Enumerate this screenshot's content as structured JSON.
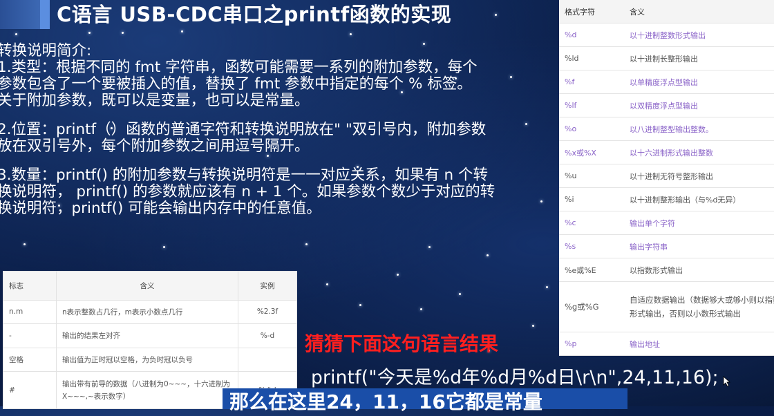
{
  "slide": {
    "title": "C语言 USB-CDC串口之printf函数的实现",
    "body_lines": [
      "转换说明简介:",
      "1.类型：根据不同的 fmt 字符串，函数可能需要一系列的附加参数，每个",
      "参数包含了一个要被插入的值，替换了 fmt 参数中指定的每个 % 标签。",
      "关于附加参数，既可以是变量，也可以是常量。",
      "",
      "2.位置：printf（）函数的普通字符和转换说明放在\" \"双引号内，附加参数",
      "放在双引号外，每个附加参数之间用逗号隔开。",
      "",
      "3.数量：printf() 的附加参数与转换说明符是一一对应关系，如果有 n 个转",
      "换说明符， printf() 的参数就应该有 n + 1 个。如果参数个数少于对应的转",
      "换说明符，printf() 可能会输出内存中的任意值。"
    ],
    "question": "猜猜下面这句语言结果",
    "code": "printf(\"今天是%d年%d月%d日\\r\\n\",24,11,16);",
    "bottom_text": "那么在这里24，11，16它都是常量"
  },
  "format_table": {
    "headers": [
      "格式字符",
      "含义"
    ],
    "rows": [
      {
        "spec": "%d",
        "desc": "以十进制整数形式输出"
      },
      {
        "spec": "%ld",
        "desc": "以十进制长整形输出"
      },
      {
        "spec": "%f",
        "desc": "以单精度浮点型输出"
      },
      {
        "spec": "%lf",
        "desc": "以双精度浮点型输出"
      },
      {
        "spec": "%o",
        "desc": "以八进制整型输出整数。"
      },
      {
        "spec": "%x或%X",
        "desc": "以十六进制形式输出整数"
      },
      {
        "spec": "%u",
        "desc": "以十进制无符号整形输出"
      },
      {
        "spec": "%i",
        "desc": "以十进制整形输出（与%d无异）"
      },
      {
        "spec": "%c",
        "desc": "输出单个字符"
      },
      {
        "spec": "%s",
        "desc": "输出字符串"
      },
      {
        "spec": "%e或%E",
        "desc": "以指数形式输出"
      },
      {
        "spec": "%g或%G",
        "desc": "自适应数据输出（数据够大或够小则以指数形式输出，否则以小数形式输出"
      },
      {
        "spec": "%p",
        "desc": "输出地址"
      }
    ]
  },
  "flag_table": {
    "headers": [
      "标志",
      "含义",
      "实例"
    ],
    "rows": [
      {
        "flag": "n.m",
        "desc": "n表示整数占几行，m表示小数点几行",
        "example": "%2.3f"
      },
      {
        "flag": "-",
        "desc": "输出的结果左对齐",
        "example": "%-d"
      },
      {
        "flag": "空格",
        "desc": "输出值为正时冠以空格，为负时冠以负号",
        "example": ""
      },
      {
        "flag": "#",
        "desc": "输出带有前导的数据（八进制为0~~~，十六进制为X~~~,~表示数字）",
        "example": "%#d"
      }
    ]
  },
  "colors": {
    "purple_text": "#8a63c8",
    "question_red": "#ff1f1f",
    "bottom_bar": "#1a4ea8"
  }
}
